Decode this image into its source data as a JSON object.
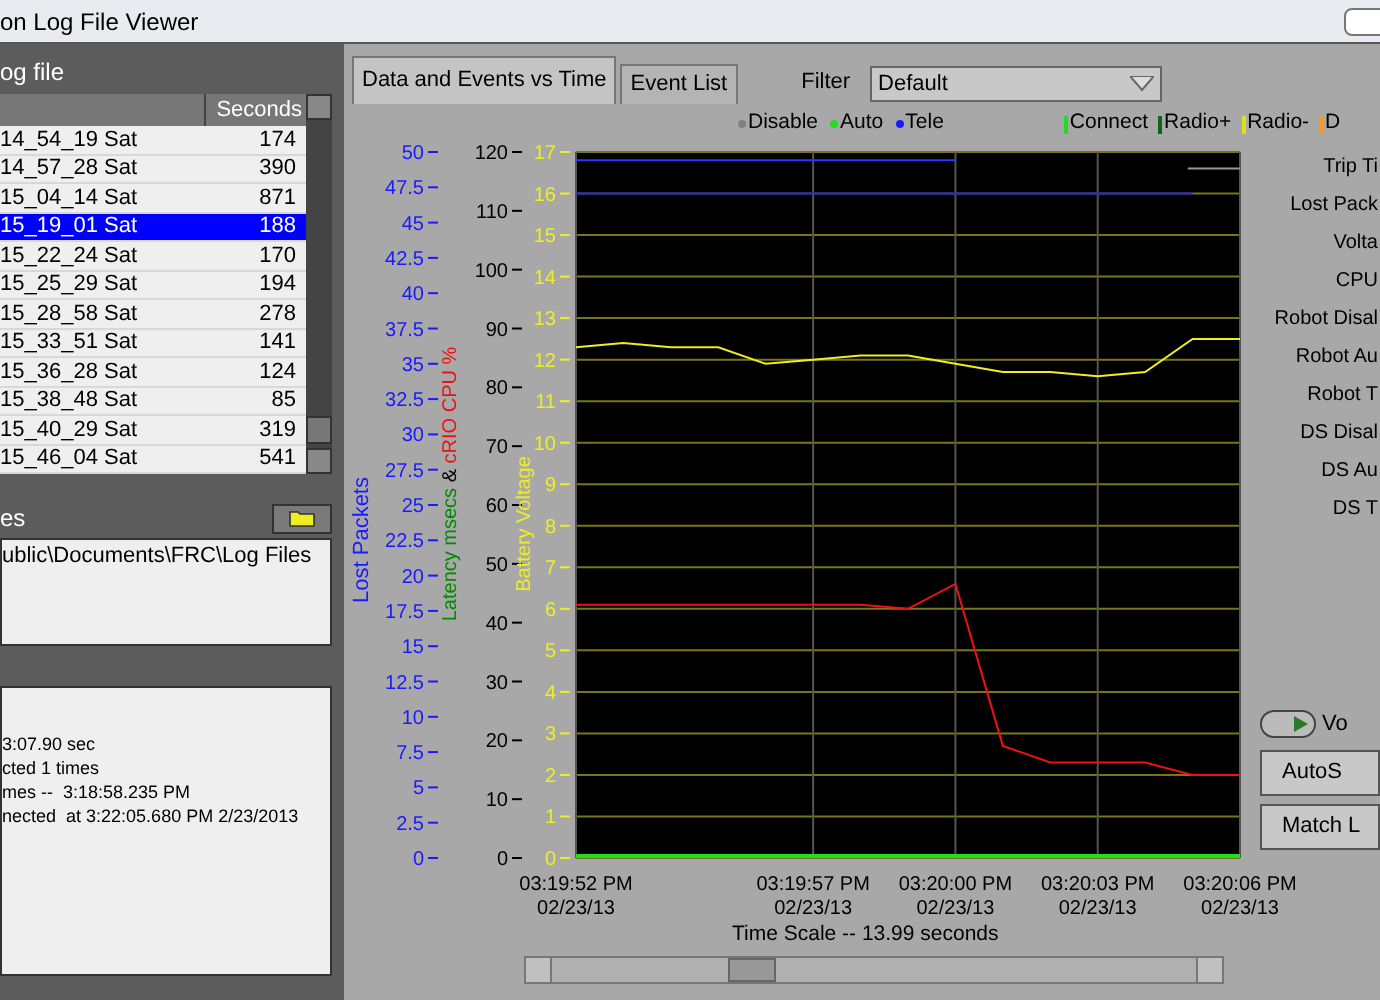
{
  "window": {
    "title": "on Log File Viewer"
  },
  "log_file": {
    "label": "og file",
    "columns": [
      "",
      "Seconds"
    ],
    "rows": [
      {
        "name": "14_54_19 Sat",
        "seconds": "174",
        "selected": false
      },
      {
        "name": "14_57_28 Sat",
        "seconds": "390",
        "selected": false
      },
      {
        "name": "15_04_14 Sat",
        "seconds": "871",
        "selected": false
      },
      {
        "name": "15_19_01 Sat",
        "seconds": "188",
        "selected": true
      },
      {
        "name": "15_22_24 Sat",
        "seconds": "170",
        "selected": false
      },
      {
        "name": "15_25_29 Sat",
        "seconds": "194",
        "selected": false
      },
      {
        "name": "15_28_58 Sat",
        "seconds": "278",
        "selected": false
      },
      {
        "name": "15_33_51 Sat",
        "seconds": "141",
        "selected": false
      },
      {
        "name": "15_36_28 Sat",
        "seconds": "124",
        "selected": false
      },
      {
        "name": "15_38_48 Sat",
        "seconds": "85",
        "selected": false
      },
      {
        "name": "15_40_29 Sat",
        "seconds": "319",
        "selected": false
      },
      {
        "name": "15_46_04 Sat",
        "seconds": "541",
        "selected": false
      }
    ]
  },
  "log_folder": {
    "label": "es",
    "path": "ublic\\Documents\\FRC\\Log Files"
  },
  "summary": [
    "3:07.90 sec",
    "cted 1 times",
    "mes --  3:18:58.235 PM",
    "nected  at 3:22:05.680 PM 2/23/2013"
  ],
  "tabs": [
    {
      "label": "Data and Events vs Time",
      "selected": true
    },
    {
      "label": "Event List",
      "selected": false
    }
  ],
  "filter": {
    "label": "Filter",
    "value": "Default"
  },
  "mode_legend": [
    {
      "label": "Disable",
      "color": "#808080"
    },
    {
      "label": "Auto",
      "color": "#22dd22"
    },
    {
      "label": "Tele",
      "color": "#1a1aff"
    }
  ],
  "event_legend": [
    {
      "label": "Connect",
      "color": "#22dd22"
    },
    {
      "label": "Radio+",
      "color": "#116611"
    },
    {
      "label": "Radio-",
      "color": "#dddd22"
    },
    {
      "label": "D",
      "color": "#ff9922"
    }
  ],
  "axes": [
    {
      "title": "Lost Packets",
      "color": "#1a1aff",
      "ticks": [
        "50",
        "47.5",
        "45",
        "42.5",
        "40",
        "37.5",
        "35",
        "32.5",
        "30",
        "27.5",
        "25",
        "22.5",
        "20",
        "17.5",
        "15",
        "12.5",
        "10",
        "7.5",
        "5",
        "2.5",
        "0"
      ]
    },
    {
      "title": "Latency msecs",
      "second_title": "&",
      "color": "#000000",
      "ticks": [
        "120",
        "110",
        "100",
        "90",
        "80",
        "70",
        "60",
        "50",
        "40",
        "30",
        "20",
        "10",
        "0"
      ]
    }
  ],
  "chart_data": {
    "type": "line",
    "categories": [
      "03:19:52 PM 02/23/13",
      null,
      null,
      null,
      null,
      "03:19:57 PM 02/23/13",
      null,
      null,
      "03:20:00 PM 02/23/13",
      null,
      null,
      "03:20:03 PM 02/23/13",
      null,
      null,
      "03:20:06 PM 02/23/13"
    ],
    "ylim": [
      0,
      17
    ],
    "yticks": [
      0,
      1,
      2,
      3,
      4,
      5,
      6,
      7,
      8,
      9,
      10,
      11,
      12,
      13,
      14,
      15,
      16,
      17
    ],
    "grid": true,
    "series": [
      {
        "name": "Battery Voltage",
        "color": "#eeee22",
        "values": [
          12.3,
          12.4,
          12.3,
          12.3,
          11.9,
          12.0,
          12.1,
          12.1,
          11.9,
          11.7,
          11.7,
          11.6,
          11.7,
          12.5,
          12.5
        ]
      },
      {
        "name": "cRIO CPU %",
        "color": "#ee1111",
        "values": [
          6.1,
          6.1,
          6.1,
          6.1,
          6.1,
          6.1,
          6.1,
          6.0,
          6.6,
          2.7,
          2.3,
          2.3,
          2.3,
          2.0,
          2.0
        ]
      },
      {
        "color": "#3333ff",
        "values": [
          16.8,
          16.8,
          16.8,
          16.8,
          16.8,
          16.8,
          16.8,
          16.8,
          16.8,
          null,
          null,
          null,
          null,
          null,
          null
        ]
      },
      {
        "color": "#2222ee",
        "values": [
          16.0,
          16.0,
          16.0,
          16.0,
          16.0,
          16.0,
          16.0,
          16.0,
          16.0,
          16.0,
          16.0,
          16.0,
          16.0,
          16.0,
          null
        ]
      }
    ]
  },
  "time_scale": "Time Scale -- 13.99 seconds",
  "stats": [
    "Trip Ti",
    "Lost Pack",
    "Volta",
    "CPU",
    "Robot Disal",
    "Robot Au",
    "Robot T",
    "DS Disal",
    "DS Au",
    "DS T"
  ],
  "toggle": {
    "label": "Vo",
    "on": true
  },
  "buttons": [
    "AutoS",
    "Match L"
  ]
}
